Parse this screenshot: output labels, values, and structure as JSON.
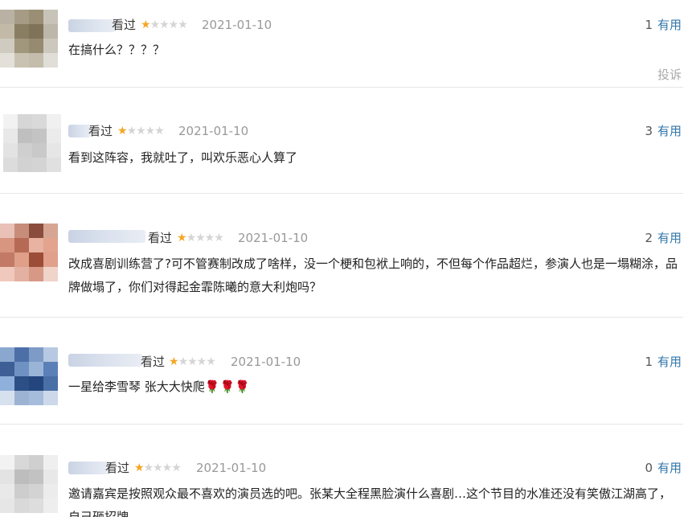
{
  "comments": [
    {
      "watched": "看过",
      "rating": 1,
      "date": "2021-01-10",
      "useful_count": "1",
      "useful_label": "有用",
      "text": "在搞什么？？？？",
      "report": "投诉"
    },
    {
      "watched": "看过",
      "rating": 1,
      "date": "2021-01-10",
      "useful_count": "3",
      "useful_label": "有用",
      "text": "看到这阵容，我就吐了，叫欢乐恶心人算了"
    },
    {
      "watched": "看过",
      "rating": 1,
      "date": "2021-01-10",
      "useful_count": "2",
      "useful_label": "有用",
      "text": "改成喜剧训练营了?可不管赛制改成了啥样，没一个梗和包袱上响的，不但每个作品超烂，参演人也是一塌糊涂，品牌做塌了，你们对得起金霏陈曦的意大利炮吗？"
    },
    {
      "watched": "看过",
      "rating": 1,
      "date": "2021-01-10",
      "useful_count": "1",
      "useful_label": "有用",
      "text": "一星给李雪琴 张大大快爬🌹🌹🌹"
    },
    {
      "watched": "看过",
      "rating": 1,
      "date": "2021-01-10",
      "useful_count": "0",
      "useful_label": "有用",
      "text": "邀请嘉宾是按照观众最不喜欢的演员选的吧。张某大全程黑脸演什么喜剧…这个节目的水准还没有笑傲江湖高了，自己砸招牌"
    }
  ],
  "icons": {
    "star_filled": "star-filled-icon",
    "star_empty": "star-empty-icon"
  },
  "colors": {
    "star_on": "#f5a623",
    "star_off": "#d5d5d5",
    "link": "#3377aa",
    "date": "#999999"
  }
}
